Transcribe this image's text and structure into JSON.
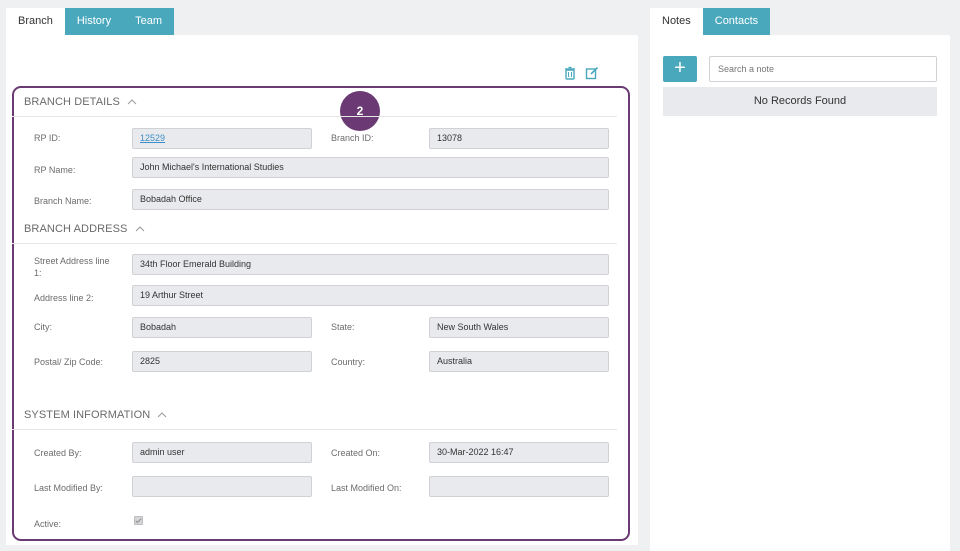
{
  "left_tabs": [
    "Branch",
    "History",
    "Team"
  ],
  "right_tabs": [
    "Notes",
    "Contacts"
  ],
  "toolbar": {
    "delete_icon": "trash-icon",
    "edit_icon": "edit-icon"
  },
  "step_badge": "2",
  "sections": {
    "branch_details": "BRANCH DETAILS",
    "branch_address": "BRANCH ADDRESS",
    "system_information": "SYSTEM INFORMATION"
  },
  "labels": {
    "rp_id": "RP ID:",
    "branch_id": "Branch ID:",
    "rp_name": "RP Name:",
    "branch_name": "Branch Name:",
    "street_line1_a": "Street Address line",
    "street_line1_b": "1:",
    "address_line2": "Address line 2:",
    "city": "City:",
    "state": "State:",
    "postal": "Postal/ Zip Code:",
    "country": "Country:",
    "created_by": "Created By:",
    "created_on": "Created On:",
    "last_modified_by": "Last Modified By:",
    "last_modified_on": "Last Modified On:",
    "active": "Active:"
  },
  "values": {
    "rp_id": "12529",
    "branch_id": "13078",
    "rp_name": "John Michael's International Studies",
    "branch_name": "Bobadah Office",
    "street_line1": "34th Floor Emerald Building",
    "address_line2": "19 Arthur Street",
    "city": "Bobadah",
    "state": "New South Wales",
    "postal": "2825",
    "country": "Australia",
    "created_by": "admin user",
    "created_on": "30-Mar-2022 16:47",
    "last_modified_by": "",
    "last_modified_on": "",
    "active": true
  },
  "notes": {
    "add_icon": "plus-icon",
    "search_placeholder": "Search a note",
    "empty_text": "No Records Found"
  },
  "colors": {
    "accent": "#4aa8bd",
    "highlight": "#6b3a74",
    "link": "#3b8fc9"
  }
}
